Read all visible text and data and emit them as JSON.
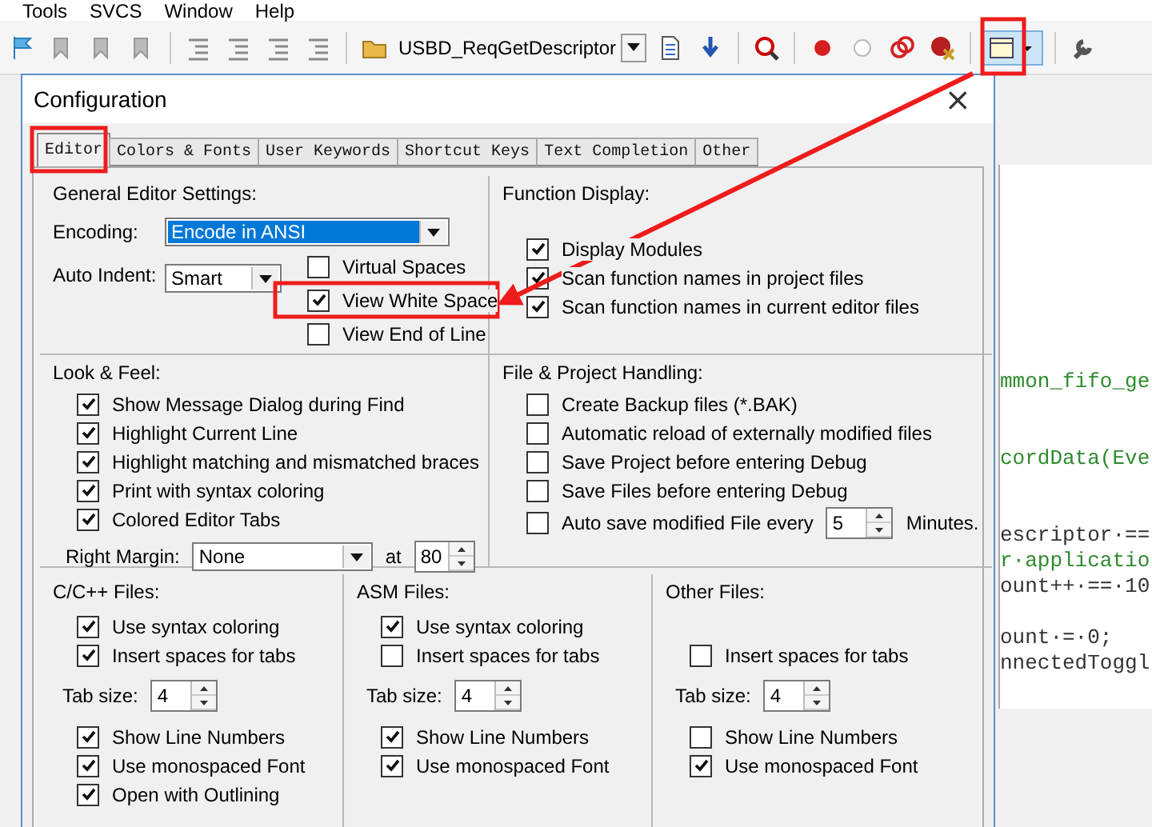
{
  "menu": [
    {
      "label": "Tools"
    },
    {
      "label": "SVCS"
    },
    {
      "label": "Window"
    },
    {
      "label": "Help"
    }
  ],
  "toolbar": {
    "target": "USBD_ReqGetDescriptor"
  },
  "code_lines": [
    {
      "kind": "comment",
      "text": "mmon_fifo_ge"
    },
    {
      "kind": "blank"
    },
    {
      "kind": "blank"
    },
    {
      "kind": "comment",
      "text": "cordData(Eve"
    },
    {
      "kind": "blank"
    },
    {
      "kind": "blank"
    },
    {
      "kind": "code",
      "text": "escriptor·=="
    },
    {
      "kind": "comment",
      "text": "r·applicatio"
    },
    {
      "kind": "code",
      "text": "ount++·==·10"
    },
    {
      "kind": "blank"
    },
    {
      "kind": "code",
      "text": "ount·=·0;"
    },
    {
      "kind": "code",
      "text": "nnectedToggl"
    }
  ],
  "dialog": {
    "title": "Configuration",
    "close": "×",
    "tabs": [
      {
        "label": "Editor",
        "selected": true
      },
      {
        "label": "Colors & Fonts",
        "selected": false
      },
      {
        "label": "User Keywords",
        "selected": false
      },
      {
        "label": "Shortcut Keys",
        "selected": false
      },
      {
        "label": "Text Completion",
        "selected": false
      },
      {
        "label": "Other",
        "selected": false
      }
    ],
    "general": {
      "title": "General Editor Settings:",
      "encoding": {
        "label": "Encoding:",
        "value": "Encode in ANSI",
        "focused": true
      },
      "auto_indent": {
        "label": "Auto Indent:",
        "value": "Smart",
        "focused": false
      },
      "options": [
        {
          "label": "Virtual Spaces",
          "checked": false
        },
        {
          "label": "View White Space",
          "checked": true
        },
        {
          "label": "View End of Line",
          "checked": false
        }
      ]
    },
    "function_display": {
      "title": "Function Display:",
      "options": [
        {
          "label": "Display Modules",
          "checked": true
        },
        {
          "label": "Scan function names in project files",
          "checked": true
        },
        {
          "label": "Scan function names in current editor files",
          "checked": true
        }
      ]
    },
    "look_feel": {
      "title": "Look & Feel:",
      "options": [
        {
          "label": "Show Message Dialog during Find",
          "checked": true
        },
        {
          "label": "Highlight Current Line",
          "checked": true
        },
        {
          "label": "Highlight matching and mismatched braces",
          "checked": true
        },
        {
          "label": "Print with syntax coloring",
          "checked": true
        },
        {
          "label": "Colored Editor Tabs",
          "checked": true
        }
      ],
      "right_margin": {
        "label": "Right Margin:",
        "value": "None",
        "at_label": "at",
        "at_value": "80"
      }
    },
    "file_project": {
      "title": "File & Project Handling:",
      "options": [
        {
          "label": "Create Backup files (*.BAK)",
          "checked": false
        },
        {
          "label": "Automatic reload of externally modified files",
          "checked": false
        },
        {
          "label": "Save Project before entering Debug",
          "checked": false
        },
        {
          "label": "Save Files before entering Debug",
          "checked": false
        },
        {
          "label": "Auto save modified File every",
          "checked": false,
          "value": "5",
          "suffix": "Minutes."
        }
      ]
    },
    "file_types": [
      {
        "title": "C/C++ Files:",
        "items": [
          {
            "kind": "check",
            "label": "Use syntax coloring",
            "checked": true
          },
          {
            "kind": "check",
            "label": "Insert spaces for tabs",
            "checked": true
          },
          {
            "kind": "tabsize",
            "label": "Tab size:",
            "value": "4"
          },
          {
            "kind": "check",
            "label": "Show Line Numbers",
            "checked": true
          },
          {
            "kind": "check",
            "label": "Use monospaced Font",
            "checked": true
          },
          {
            "kind": "check",
            "label": "Open with Outlining",
            "checked": true
          }
        ]
      },
      {
        "title": "ASM Files:",
        "items": [
          {
            "kind": "check",
            "label": "Use syntax coloring",
            "checked": true
          },
          {
            "kind": "check",
            "label": "Insert spaces for tabs",
            "checked": false
          },
          {
            "kind": "tabsize",
            "label": "Tab size:",
            "value": "4"
          },
          {
            "kind": "check",
            "label": "Show Line Numbers",
            "checked": true
          },
          {
            "kind": "check",
            "label": "Use monospaced Font",
            "checked": true
          }
        ]
      },
      {
        "title": "Other Files:",
        "items": [
          {
            "kind": "spacer"
          },
          {
            "kind": "check",
            "label": "Insert spaces for tabs",
            "checked": false
          },
          {
            "kind": "tabsize",
            "label": "Tab size:",
            "value": "4"
          },
          {
            "kind": "check",
            "label": "Show Line Numbers",
            "checked": false
          },
          {
            "kind": "check",
            "label": "Use monospaced Font",
            "checked": true
          }
        ]
      }
    ]
  }
}
